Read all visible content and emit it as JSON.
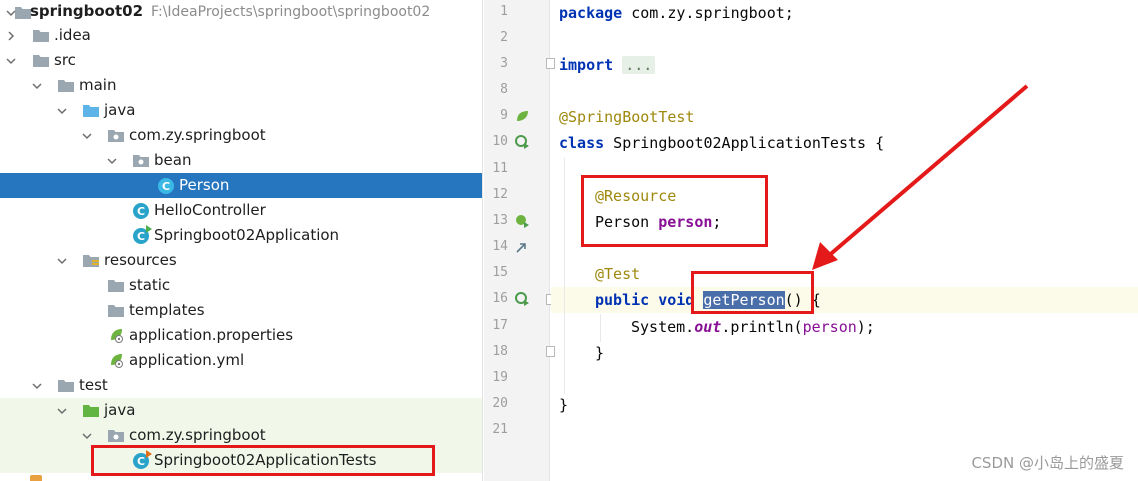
{
  "project_tree": {
    "root": {
      "name": "springboot02",
      "path": "F:\\IdeaProjects\\springboot\\springboot02"
    },
    "items": [
      {
        "label": ".idea"
      },
      {
        "label": "src"
      },
      {
        "label": "main"
      },
      {
        "label": "java"
      },
      {
        "label": "com.zy.springboot"
      },
      {
        "label": "bean"
      },
      {
        "label": "Person"
      },
      {
        "label": "HelloController"
      },
      {
        "label": "Springboot02Application"
      },
      {
        "label": "resources"
      },
      {
        "label": "static"
      },
      {
        "label": "templates"
      },
      {
        "label": "application.properties"
      },
      {
        "label": "application.yml"
      },
      {
        "label": "test"
      },
      {
        "label": "java"
      },
      {
        "label": "com.zy.springboot"
      },
      {
        "label": "Springboot02ApplicationTests"
      }
    ],
    "class_badge": "C"
  },
  "editor": {
    "line_numbers": [
      "1",
      "2",
      "3",
      "8",
      "9",
      "10",
      "11",
      "12",
      "13",
      "14",
      "15",
      "16",
      "17",
      "18",
      "19",
      "20",
      "21"
    ],
    "code": {
      "l1_kw": "package",
      "l1_rest": " com.zy.springboot;",
      "l3_kw": "import",
      "l3_fold": "...",
      "l9_ann": "@SpringBootTest",
      "l10_kw": "class",
      "l10_rest": " Springboot02ApplicationTests {",
      "l12_ann": "@Resource",
      "l13_type": "Person ",
      "l13_field": "person",
      "l13_end": ";",
      "l15_ann": "@Test",
      "l16_kw1": "public",
      "l16_kw2": " void ",
      "l16_method": "getPerson",
      "l16_rest": "() {",
      "l17_a": "System.",
      "l17_out": "out",
      "l17_b": ".println(",
      "l17_arg": "person",
      "l17_c": ");",
      "l18": "}",
      "l20": "}"
    }
  },
  "watermark": "CSDN @小岛上的盛夏",
  "colors": {
    "selection": "#2675bf",
    "annotation_red": "#e41a1a",
    "keyword": "#0033b3",
    "annotation": "#9e880d",
    "field": "#871094"
  }
}
